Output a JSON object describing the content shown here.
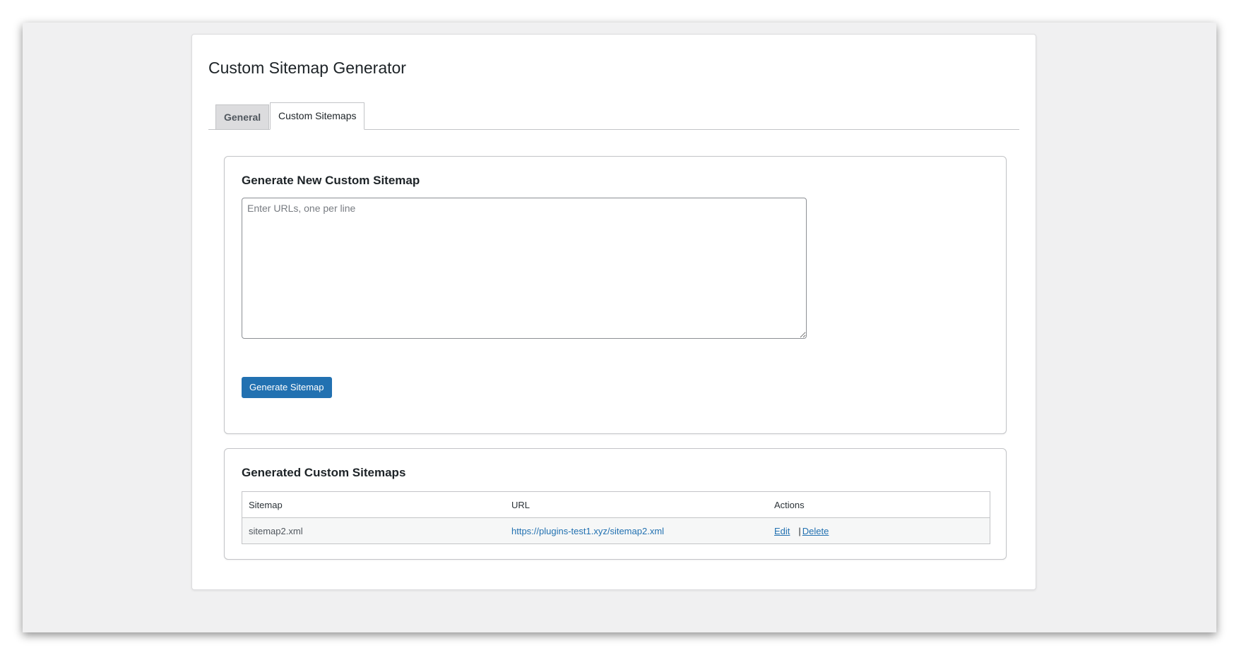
{
  "page": {
    "title": "Custom Sitemap Generator"
  },
  "tabs": [
    {
      "label": "General",
      "active": false
    },
    {
      "label": "Custom Sitemaps",
      "active": true
    }
  ],
  "generate_section": {
    "heading": "Generate New Custom Sitemap",
    "textarea_placeholder": "Enter URLs, one per line",
    "textarea_value": "",
    "button_label": "Generate Sitemap"
  },
  "list_section": {
    "heading": "Generated Custom Sitemaps",
    "columns": [
      "Sitemap",
      "URL",
      "Actions"
    ],
    "rows": [
      {
        "sitemap": "sitemap2.xml",
        "url": "https://plugins-test1.xyz/sitemap2.xml",
        "edit_label": "Edit",
        "separator": "|",
        "delete_label": "Delete"
      }
    ]
  },
  "colors": {
    "accent": "#2271b1",
    "background": "#f0f0f1",
    "border": "#c3c4c7"
  }
}
